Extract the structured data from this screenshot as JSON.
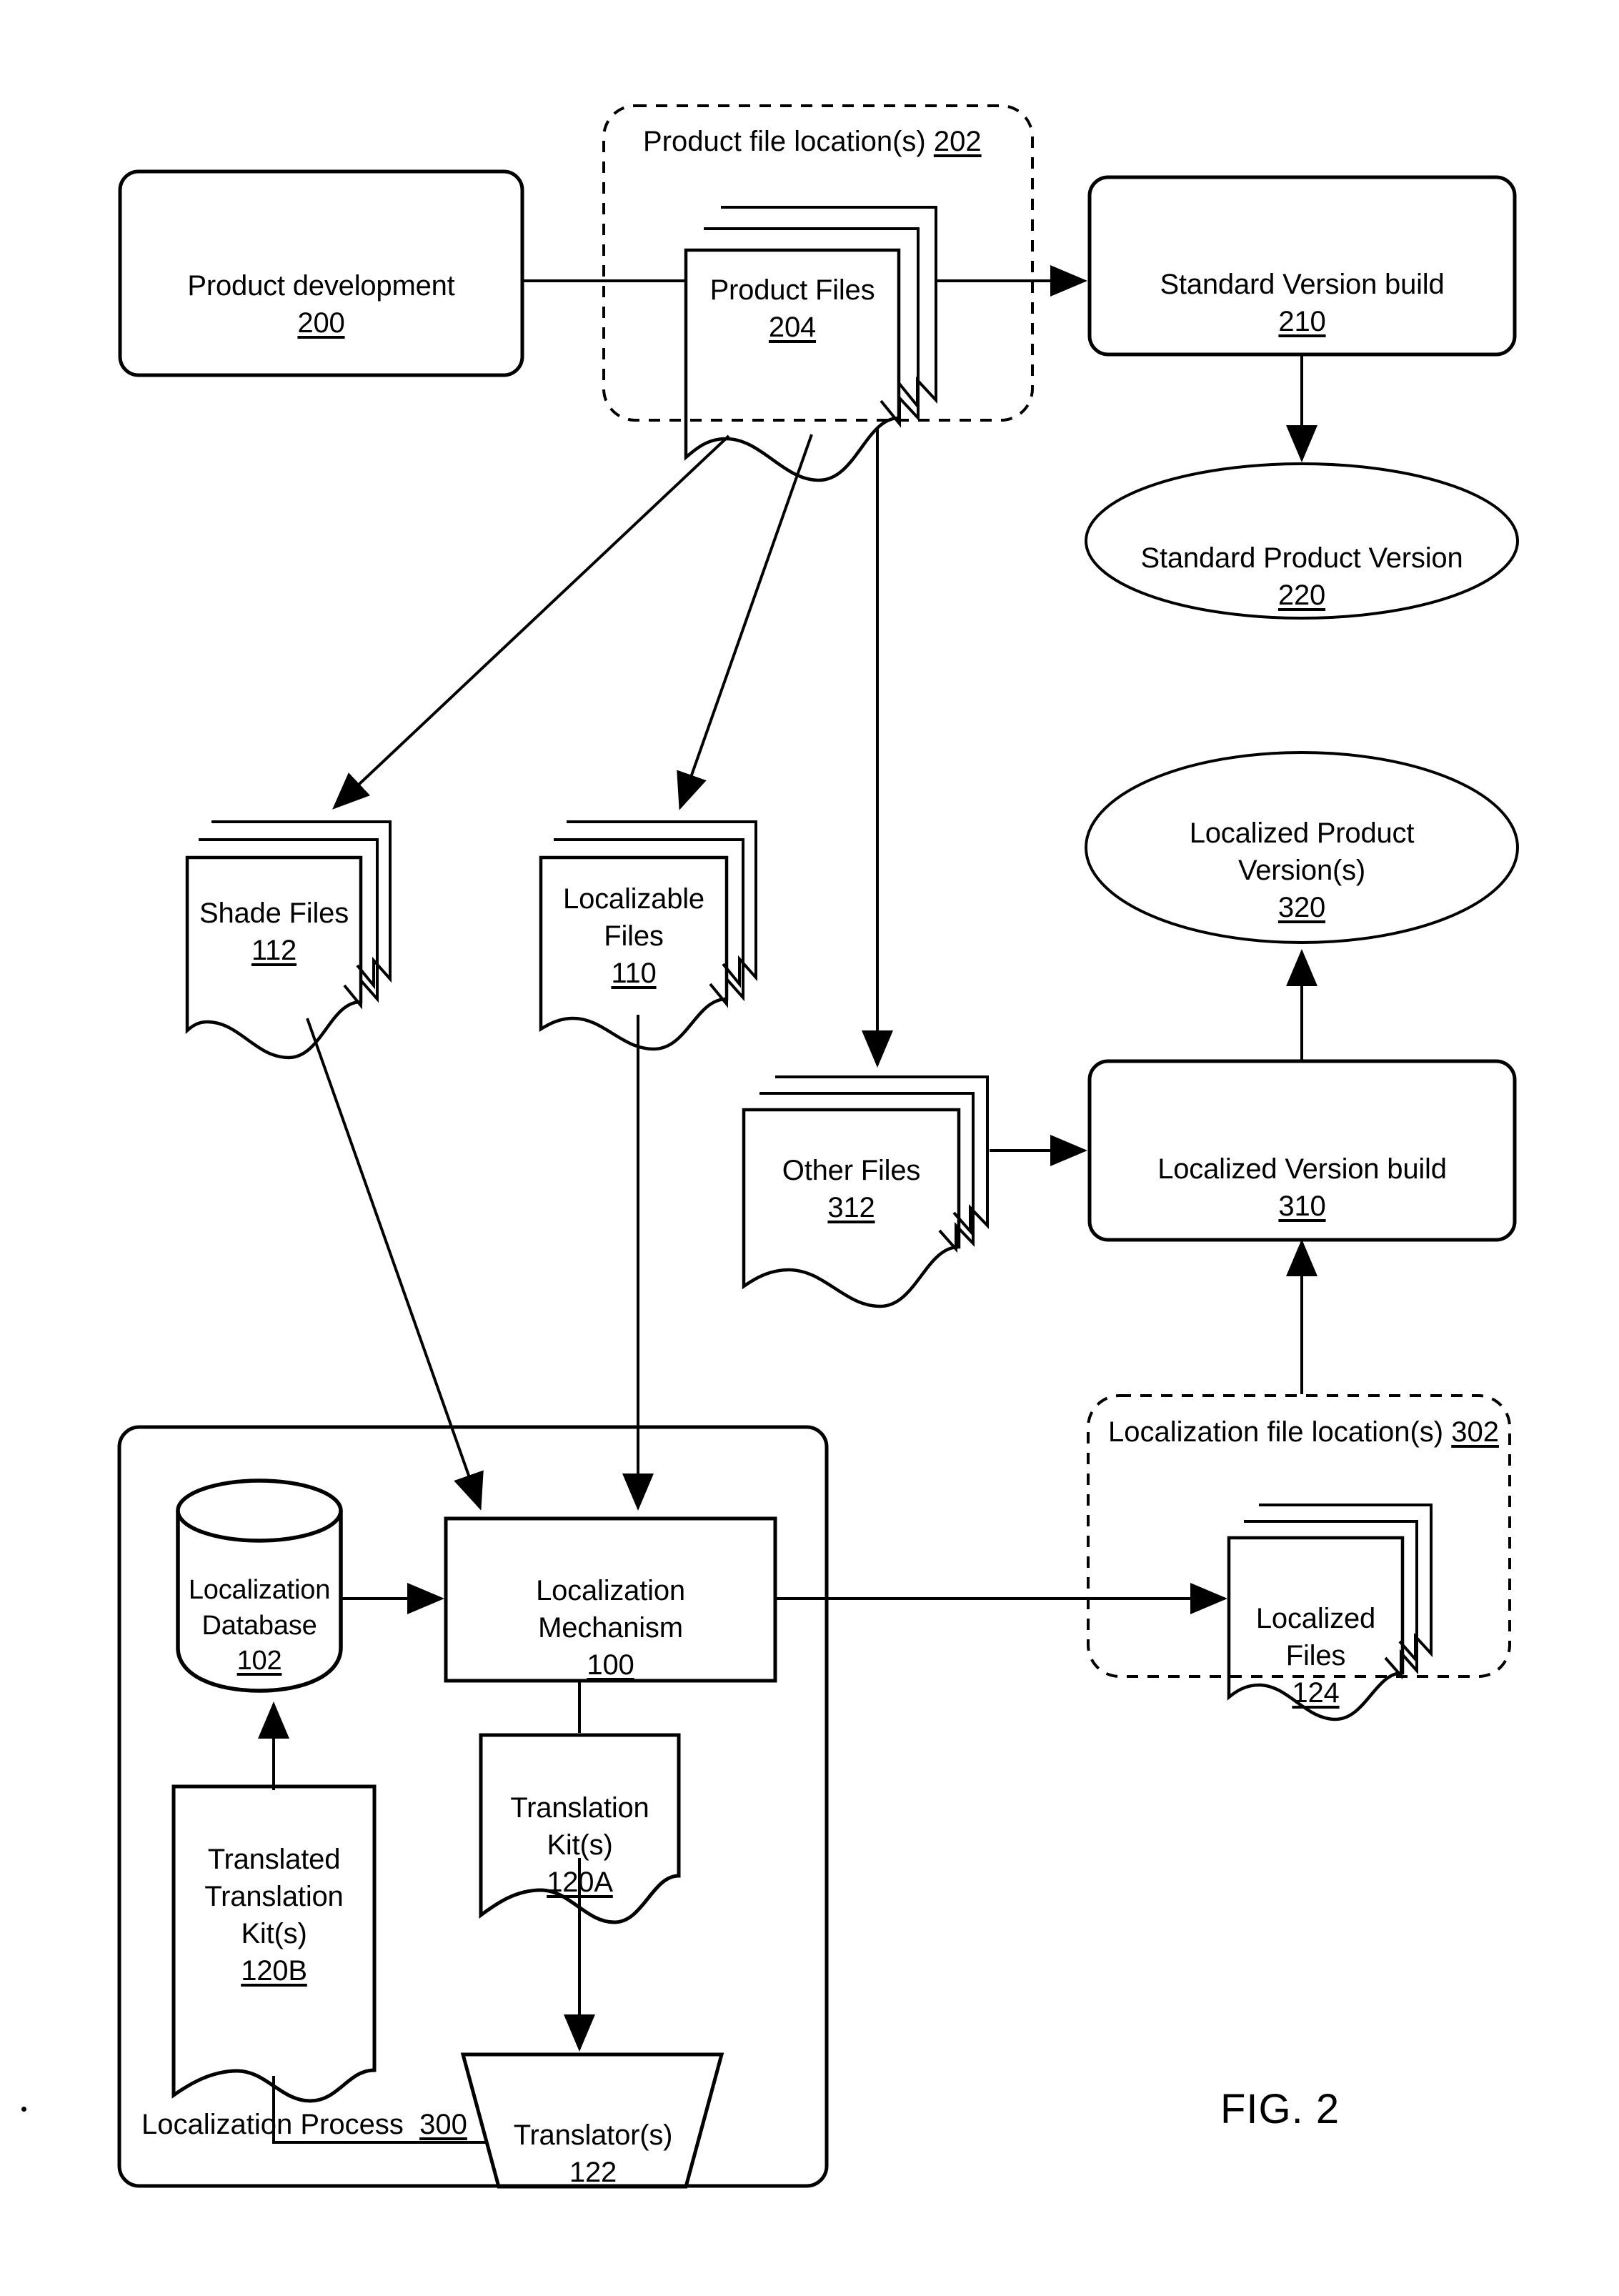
{
  "figure": {
    "caption": "FIG. 2"
  },
  "containers": [
    {
      "id": "product-file-location",
      "title": "Product file location(s)",
      "number": "202"
    },
    {
      "id": "localization-file-location",
      "title": "Localization file location(s)",
      "number": "302"
    },
    {
      "id": "localization-process",
      "title": "Localization Process",
      "number": "300"
    }
  ],
  "nodes": {
    "product_development": {
      "label": "Product development",
      "number": "200",
      "shape": "rounded-rect"
    },
    "product_files": {
      "label": "Product Files",
      "number": "204",
      "shape": "document-stack"
    },
    "standard_version_build": {
      "label": "Standard Version build",
      "number": "210",
      "shape": "rounded-rect"
    },
    "standard_product_version": {
      "label": "Standard Product Version",
      "number": "220",
      "shape": "ellipse"
    },
    "shade_files": {
      "label": "Shade Files",
      "number": "112",
      "shape": "document-stack"
    },
    "localizable_files": {
      "label": "Localizable\nFiles",
      "number": "110",
      "shape": "document-stack"
    },
    "other_files": {
      "label": "Other Files",
      "number": "312",
      "shape": "document-stack"
    },
    "localized_version_build": {
      "label": "Localized Version build",
      "number": "310",
      "shape": "rounded-rect"
    },
    "localized_product_version": {
      "label": "Localized Product\nVersion(s)",
      "number": "320",
      "shape": "ellipse"
    },
    "localized_files": {
      "label": "Localized Files",
      "number": "124",
      "shape": "document-stack"
    },
    "localization_database": {
      "label": "Localization\nDatabase",
      "number": "102",
      "shape": "cylinder"
    },
    "localization_mechanism": {
      "label": "Localization\nMechanism",
      "number": "100",
      "shape": "rect"
    },
    "translation_kits": {
      "label": "Translation\nKit(s)",
      "number": "120A",
      "shape": "document"
    },
    "translated_translation_kits": {
      "label": "Translated\nTranslation\nKit(s)",
      "number": "120B",
      "shape": "document"
    },
    "translators": {
      "label": "Translator(s)",
      "number": "122",
      "shape": "trapezoid"
    }
  },
  "colors": {
    "stroke": "#000000",
    "background": "#ffffff"
  }
}
